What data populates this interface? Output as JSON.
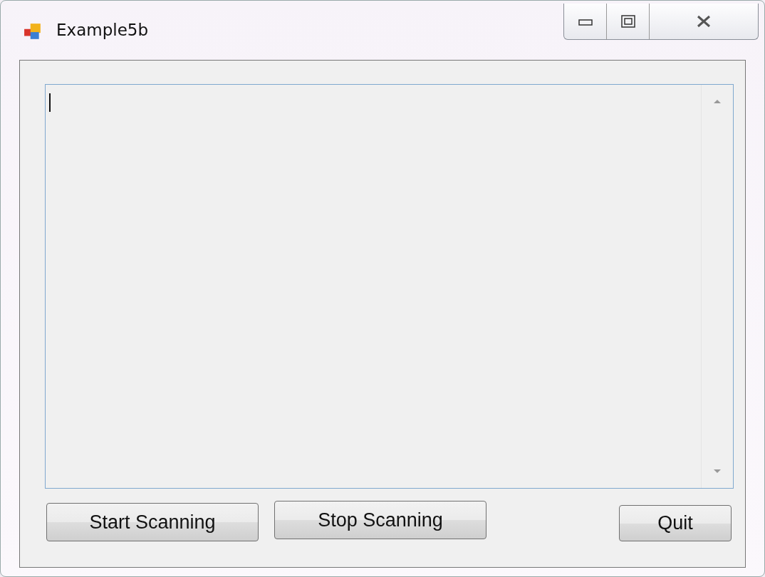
{
  "window": {
    "title": "Example5b"
  },
  "text_area": {
    "focused": true
  },
  "buttons": [
    {
      "label": "Start Scanning"
    },
    {
      "label": "Stop Scanning"
    },
    {
      "label": "Quit"
    }
  ]
}
